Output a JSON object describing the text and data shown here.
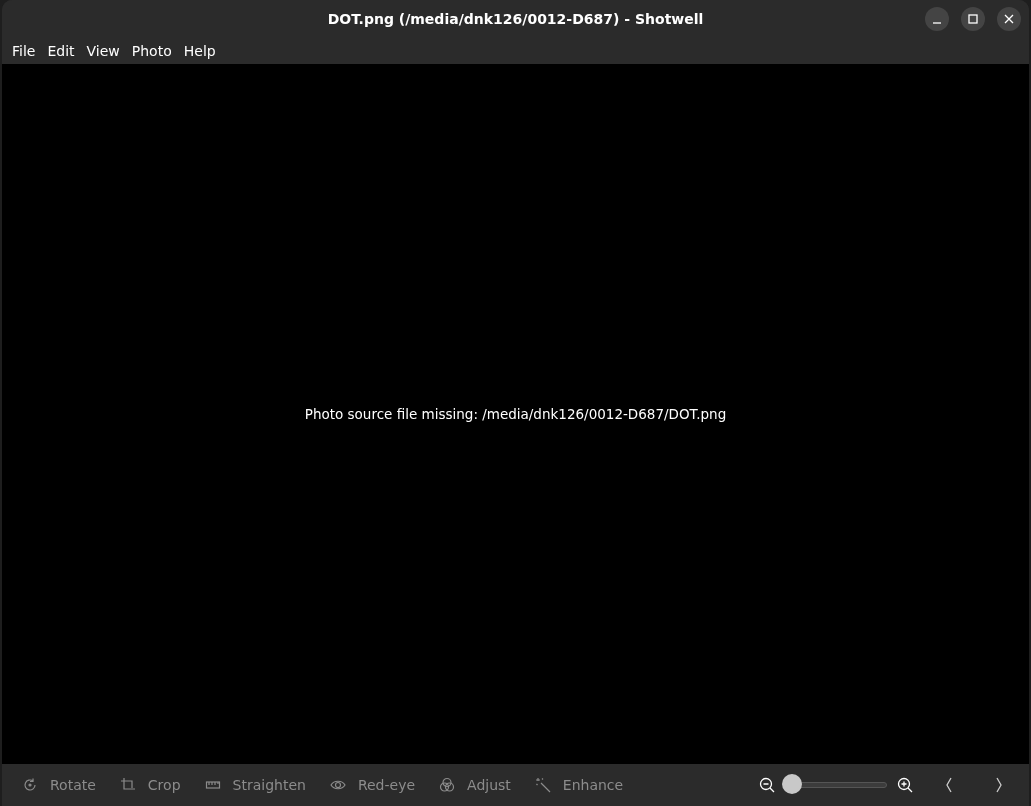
{
  "window": {
    "title": "DOT.png (/media/dnk126/0012-D687) - Shotwell"
  },
  "menu": [
    "File",
    "Edit",
    "View",
    "Photo",
    "Help"
  ],
  "viewer": {
    "message": "Photo source file missing: /media/dnk126/0012-D687/DOT.png"
  },
  "tools": [
    {
      "kind": "rotate",
      "label": "Rotate",
      "disabled": true
    },
    {
      "kind": "crop",
      "label": "Crop",
      "disabled": true
    },
    {
      "kind": "straighten",
      "label": "Straighten",
      "disabled": true
    },
    {
      "kind": "redeye",
      "label": "Red-eye",
      "disabled": true
    },
    {
      "kind": "adjust",
      "label": "Adjust",
      "disabled": true
    },
    {
      "kind": "enhance",
      "label": "Enhance",
      "disabled": true
    }
  ],
  "zoom": {
    "level": 0
  }
}
